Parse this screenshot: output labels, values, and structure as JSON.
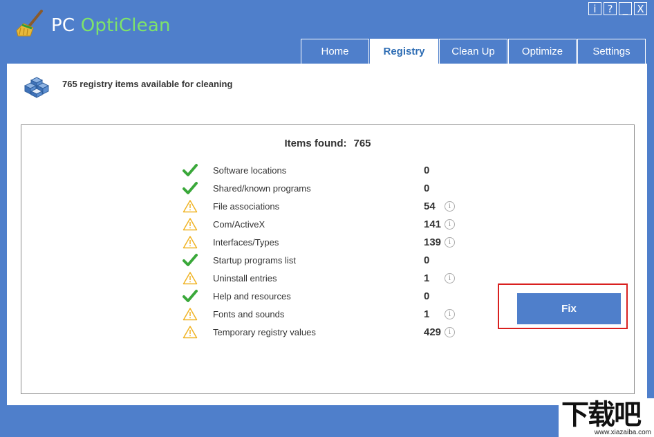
{
  "app": {
    "title_prefix": "PC ",
    "title_highlight": "OptiClean",
    "logo_icon": "broom-icon"
  },
  "window_controls": {
    "info": "i",
    "help": "?",
    "minimize": "_",
    "close": "X"
  },
  "tabs": [
    {
      "label": "Home",
      "active": false
    },
    {
      "label": "Registry",
      "active": true
    },
    {
      "label": "Clean Up",
      "active": false
    },
    {
      "label": "Optimize",
      "active": false
    },
    {
      "label": "Settings",
      "active": false
    }
  ],
  "header": {
    "icon": "registry-cubes-icon",
    "message": "765 registry items available for cleaning"
  },
  "results": {
    "found_label": "Items found:",
    "found_count": "765",
    "items": [
      {
        "label": "Software locations",
        "count": "0",
        "status": "ok"
      },
      {
        "label": "Shared/known programs",
        "count": "0",
        "status": "ok"
      },
      {
        "label": "File associations",
        "count": "54",
        "status": "warning"
      },
      {
        "label": "Com/ActiveX",
        "count": "141",
        "status": "warning"
      },
      {
        "label": "Interfaces/Types",
        "count": "139",
        "status": "warning"
      },
      {
        "label": "Startup programs list",
        "count": "0",
        "status": "ok"
      },
      {
        "label": "Uninstall entries",
        "count": "1",
        "status": "warning"
      },
      {
        "label": "Help and resources",
        "count": "0",
        "status": "ok"
      },
      {
        "label": "Fonts and sounds",
        "count": "1",
        "status": "warning"
      },
      {
        "label": "Temporary registry values",
        "count": "429",
        "status": "warning"
      }
    ],
    "info_glyph": "i"
  },
  "fix_button": {
    "label": "Fix"
  },
  "watermark": {
    "main": "下载吧",
    "url": "www.xiazaiba.com"
  },
  "colors": {
    "brand_blue": "#4f7fcb",
    "tab_active_text": "#2e6db4",
    "ok_green": "#3aa83a",
    "warning_yellow": "#f0b323",
    "highlight_red": "#d9201f"
  }
}
